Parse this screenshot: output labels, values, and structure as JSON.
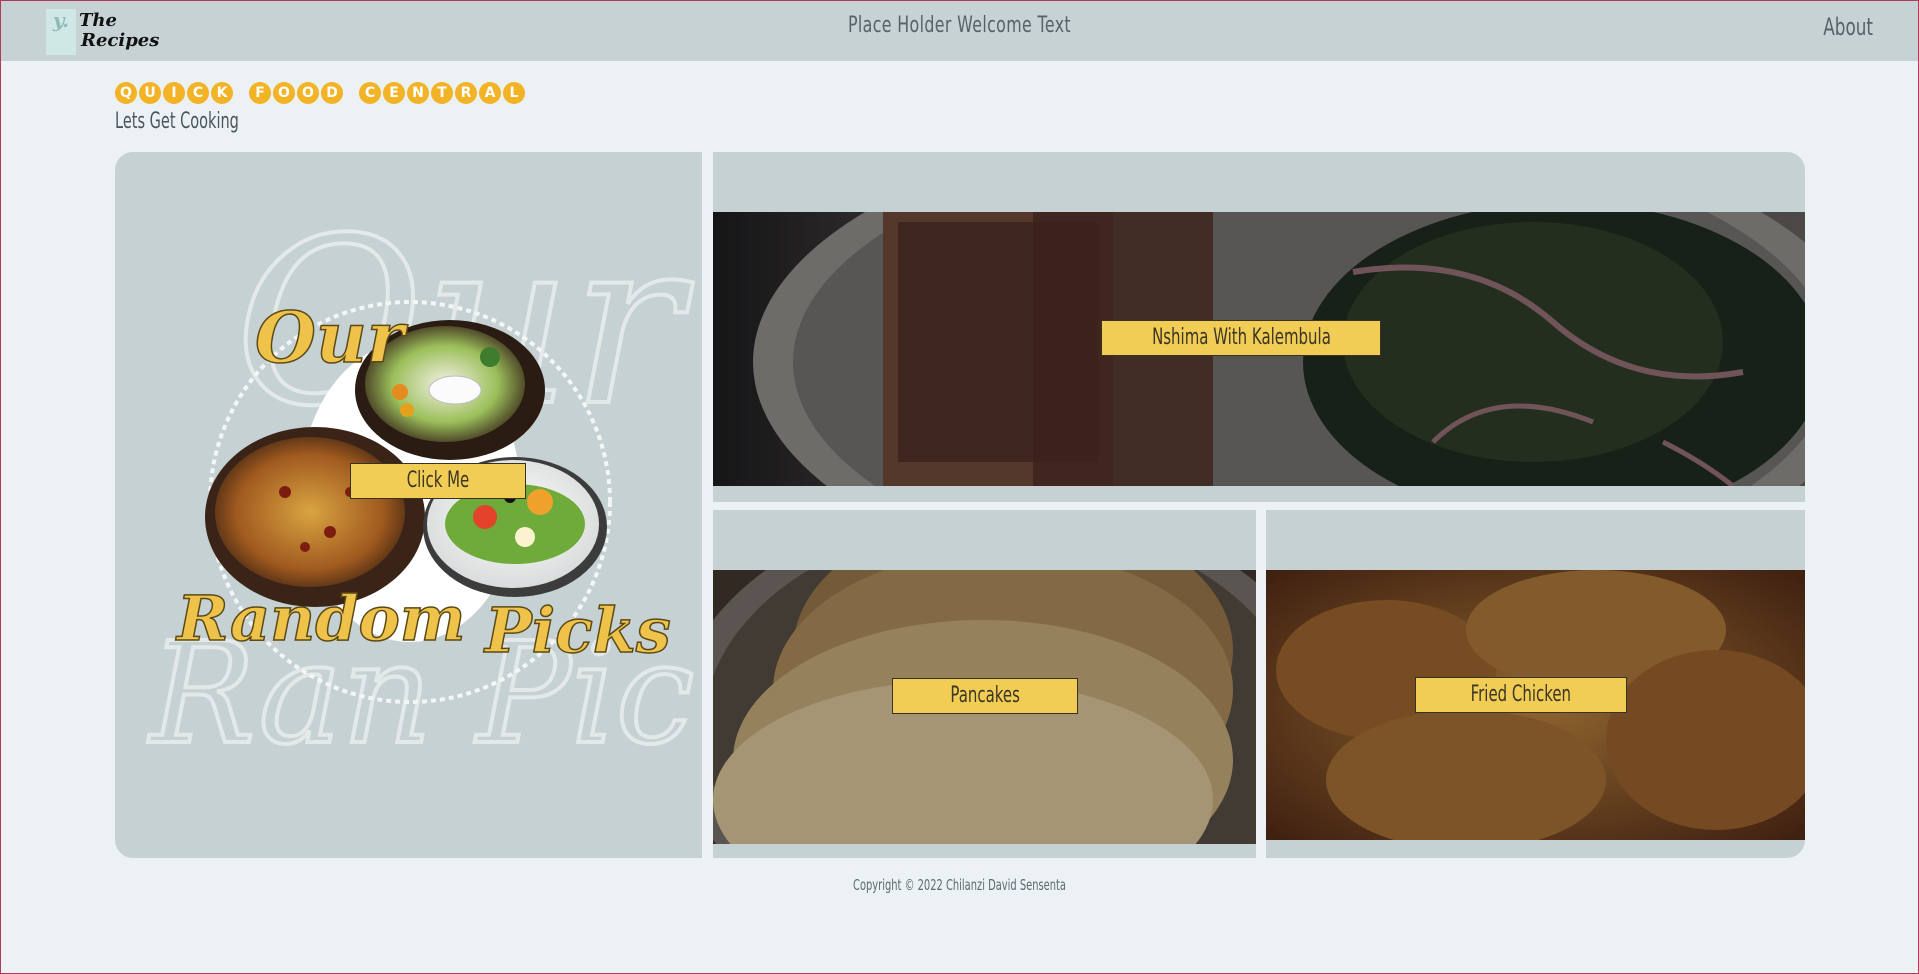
{
  "header": {
    "logo_line1": "The",
    "logo_line2": "Recipes",
    "logo_mark": "y.",
    "welcome": "Place Holder Welcome Text",
    "about": "About"
  },
  "brand": {
    "title_words": [
      "QUICK",
      "FOOD",
      "CENTRAL"
    ],
    "tagline": "Lets Get Cooking"
  },
  "random_picks": {
    "script_text_1": "Our",
    "script_text_2": "Random",
    "script_text_3": "Picks",
    "button": "Click Me"
  },
  "dishes": [
    {
      "label": "Nshima With Kalembula"
    },
    {
      "label": "Pancakes"
    },
    {
      "label": "Fried Chicken"
    }
  ],
  "footer": {
    "copyright": "Copyright © 2022 Chilanzi David Sensenta"
  },
  "colors": {
    "accent": "#f3b326",
    "label_bg": "#f1cd55",
    "panel": "#c6d1d3",
    "background": "#ecf1f3"
  }
}
